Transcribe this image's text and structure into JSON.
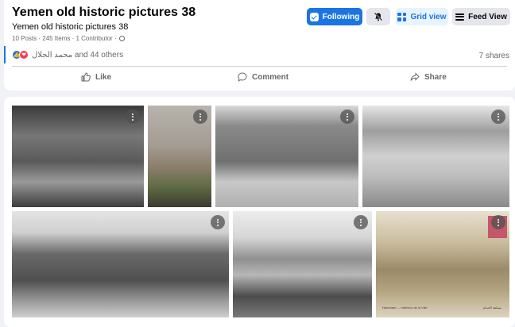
{
  "album": {
    "title": "Yemen old historic pictures 38",
    "subtitle": "Yemen old historic pictures 38",
    "meta": "10 Posts · 245 Items · 1 Contributor ·"
  },
  "buttons": {
    "following": "Following",
    "grid_view": "Grid view",
    "feed_view": "Feed View"
  },
  "reactions": {
    "summary": "محمد الجلال and 44 others",
    "shares": "7 shares"
  },
  "actions": {
    "like": "Like",
    "comment": "Comment",
    "share": "Share"
  },
  "photos": {
    "p7_caption_fr": "Hammam — Intérieur de la Ville",
    "p7_caption_ar": "مشاهد الحمام"
  },
  "colors": {
    "accent": "#1b74e4",
    "button_gray": "#e4e6eb",
    "secondary_text": "#65676b",
    "page_background": "#f0f2f5",
    "love_red": "#f33e58"
  },
  "icons": [
    "check-icon",
    "bell-off-icon",
    "grid-icon",
    "feed-icon",
    "globe-icon",
    "like-reaction-icon",
    "love-reaction-icon",
    "thumbs-up-icon",
    "comment-icon",
    "share-icon",
    "more-options-icon"
  ]
}
